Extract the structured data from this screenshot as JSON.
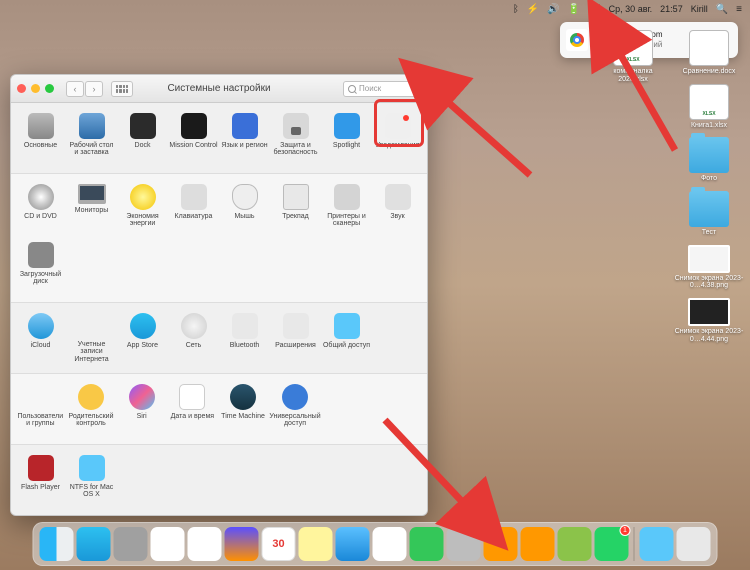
{
  "menubar": {
    "date": "Ср, 30 авг.",
    "time": "21:57",
    "user": "Kirill",
    "flag": "US"
  },
  "notification": {
    "title": "web.whatsapp.com",
    "subtitle": "Тест уведомлений"
  },
  "desktop_icons_col1": [
    {
      "label": "Сравнение.docx",
      "type": "doc-word"
    },
    {
      "label": "Книга1.xlsx",
      "type": "doc-blue"
    },
    {
      "label": "Фото",
      "type": "folder"
    },
    {
      "label": "Тест",
      "type": "folder"
    },
    {
      "label": "Снимок экрана 2023-0…4.38.png",
      "type": "screenshot light"
    },
    {
      "label": "Снимок экрана 2023-0…4.44.png",
      "type": "screenshot"
    }
  ],
  "desktop_icons_col2": [
    {
      "label": "коммуналка 2020.xlsx",
      "type": "doc-blue"
    }
  ],
  "window": {
    "title": "Системные настройки",
    "search_placeholder": "Поиск"
  },
  "prefs": {
    "row1": [
      {
        "l": "Основные",
        "ic": "ic-general"
      },
      {
        "l": "Рабочий стол и заставка",
        "ic": "ic-desktop"
      },
      {
        "l": "Dock",
        "ic": "ic-dock"
      },
      {
        "l": "Mission Control",
        "ic": "ic-mission"
      },
      {
        "l": "Язык и регион",
        "ic": "ic-lang"
      },
      {
        "l": "Защита и безопасность",
        "ic": "ic-security"
      },
      {
        "l": "Spotlight",
        "ic": "ic-spotlight"
      },
      {
        "l": "Уведомления",
        "ic": "ic-notif"
      }
    ],
    "row2": [
      {
        "l": "CD и DVD",
        "ic": "ic-cd"
      },
      {
        "l": "Мониторы",
        "ic": "ic-display"
      },
      {
        "l": "Экономия энергии",
        "ic": "ic-energy"
      },
      {
        "l": "Клавиатура",
        "ic": "ic-keyboard"
      },
      {
        "l": "Мышь",
        "ic": "ic-mouse"
      },
      {
        "l": "Трекпад",
        "ic": "ic-trackpad"
      },
      {
        "l": "Принтеры и сканеры",
        "ic": "ic-printer"
      },
      {
        "l": "Звук",
        "ic": "ic-sound"
      }
    ],
    "row2b": [
      {
        "l": "Загрузочный диск",
        "ic": "ic-startup"
      }
    ],
    "row3": [
      {
        "l": "iCloud",
        "ic": "ic-icloud"
      },
      {
        "l": "Учетные записи Интернета",
        "ic": "ic-accounts"
      },
      {
        "l": "App Store",
        "ic": "ic-appstore"
      },
      {
        "l": "Сеть",
        "ic": "ic-network"
      },
      {
        "l": "Bluetooth",
        "ic": "ic-bt"
      },
      {
        "l": "Расширения",
        "ic": "ic-ext"
      },
      {
        "l": "Общий доступ",
        "ic": "ic-sharing"
      }
    ],
    "row4": [
      {
        "l": "Пользователи и группы",
        "ic": "ic-users"
      },
      {
        "l": "Родительский контроль",
        "ic": "ic-parent"
      },
      {
        "l": "Siri",
        "ic": "ic-siri"
      },
      {
        "l": "Дата и время",
        "ic": "ic-date"
      },
      {
        "l": "Time Machine",
        "ic": "ic-time"
      },
      {
        "l": "Универсальный доступ",
        "ic": "ic-a11y"
      }
    ],
    "row5": [
      {
        "l": "Flash Player",
        "ic": "ic-flash"
      },
      {
        "l": "NTFS for Mac OS X",
        "ic": "ic-ntfs"
      }
    ]
  },
  "dock": {
    "items": [
      {
        "name": "finder",
        "cls": "d-finder"
      },
      {
        "name": "appstore",
        "cls": "d-appst"
      },
      {
        "name": "launchpad",
        "cls": "d-lpad"
      },
      {
        "name": "safari",
        "cls": "d-safari"
      },
      {
        "name": "chrome",
        "cls": "d-chrome"
      },
      {
        "name": "firefox",
        "cls": "d-firefox"
      },
      {
        "name": "calendar",
        "cls": "d-cal",
        "text": "30"
      },
      {
        "name": "notes",
        "cls": "d-notes"
      },
      {
        "name": "mail",
        "cls": "d-mail"
      },
      {
        "name": "music",
        "cls": "d-music"
      },
      {
        "name": "messages",
        "cls": "d-imsg"
      },
      {
        "name": "system-prefs",
        "cls": "d-sys"
      },
      {
        "name": "vlc",
        "cls": "d-vlc"
      },
      {
        "name": "app2",
        "cls": "d-vlc"
      },
      {
        "name": "maps",
        "cls": "d-andr"
      },
      {
        "name": "whatsapp",
        "cls": "d-wa",
        "badge": "1"
      }
    ],
    "right": [
      {
        "name": "downloads",
        "cls": "d-dl"
      },
      {
        "name": "trash",
        "cls": "d-trash"
      }
    ]
  }
}
